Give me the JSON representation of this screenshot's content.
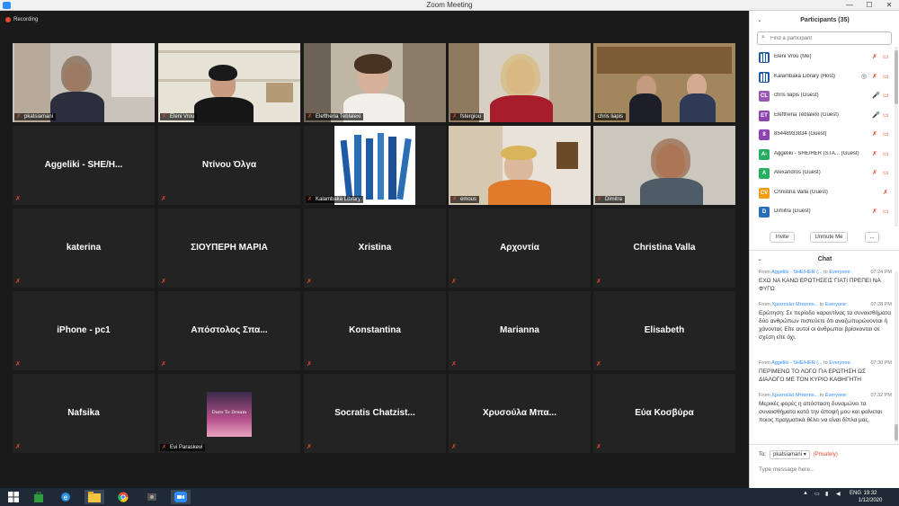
{
  "window": {
    "title": "Zoom Meeting",
    "minimize": "—",
    "maximize": "☐",
    "close": "✕"
  },
  "recording": {
    "label": "Recording"
  },
  "tiles": {
    "r1c1": {
      "name": "pkatsiamani"
    },
    "r1c2": {
      "name": "Eleni Vrou"
    },
    "r1c3": {
      "name": "Eleftheria Teblalexi"
    },
    "r1c4": {
      "name": "fstergiou"
    },
    "r1c5": {
      "name": "chris liapis"
    },
    "r2c1": {
      "big": "Aggeliki - SHE/H..."
    },
    "r2c2": {
      "big": "Ντίνου Όλγα"
    },
    "r2c3": {
      "name": "Kalambaka Library"
    },
    "r2c4": {
      "name": "emous"
    },
    "r2c5": {
      "name": "Dimitra"
    },
    "r3c1": {
      "big": "katerina"
    },
    "r3c2": {
      "big": "ΣΙΟΥΠΕΡΗ ΜΑΡΙΑ"
    },
    "r3c3": {
      "big": "Xristina"
    },
    "r3c4": {
      "big": "Αρχοντία"
    },
    "r3c5": {
      "big": "Christina Valla"
    },
    "r4c1": {
      "big": "iPhone - pc1"
    },
    "r4c2": {
      "big": "Απόστολος Σπα..."
    },
    "r4c3": {
      "big": "Konstantina"
    },
    "r4c4": {
      "big": "Marianna"
    },
    "r4c5": {
      "big": "Elisabeth"
    },
    "r5c1": {
      "big": "Nafsika"
    },
    "r5c2": {
      "name": "Evi Paraskevi",
      "image_text": "Dare To Dream"
    },
    "r5c3": {
      "big": "Socratis Chatzist..."
    },
    "r5c4": {
      "big": "Χρυσούλα Μπα..."
    },
    "r5c5": {
      "big": "Εύα Κοσβύρα"
    }
  },
  "participants": {
    "title": "Participants (35)",
    "search_placeholder": "Find a participant",
    "list": [
      {
        "initials": "",
        "color": "#2a6fb5",
        "name": "Eleni Vrou (Me)"
      },
      {
        "initials": "",
        "color": "#2a6fb5",
        "name": "Kalambaka Library (Host)"
      },
      {
        "initials": "CL",
        "color": "#9b59b6",
        "name": "chris liapis (Guest)"
      },
      {
        "initials": "ET",
        "color": "#8e44ad",
        "name": "Eleftheria Teblalexi (Guest)"
      },
      {
        "initials": "8",
        "color": "#8e44ad",
        "name": "85448933834 (Guest)"
      },
      {
        "initials": "A-",
        "color": "#27ae60",
        "name": "Aggeliki - SHE/HER (STA...  (Guest)"
      },
      {
        "initials": "A",
        "color": "#27ae60",
        "name": "Alexandros (Guest)"
      },
      {
        "initials": "CV",
        "color": "#f39c12",
        "name": "Christina Valla (Guest)"
      },
      {
        "initials": "D",
        "color": "#2a6fb5",
        "name": "Dimitra (Guest)"
      }
    ],
    "invite": "Invite",
    "unmute_me": "Unmute Me",
    "more": "..."
  },
  "chat": {
    "title": "Chat",
    "messages": [
      {
        "from_prefix": "From",
        "from": "Aggeliki - SHE/HER (...",
        "to_prefix": "to",
        "to": "Everyone:",
        "time": "07:24 PM",
        "text": "ΕΧΩ ΝΑ ΚΑΝΩ ΕΡΩΤΗΣΕΙΣ ΓΙΑΤΙ ΠΡΕΠΕΙ ΝΑ ΦΥΓΩ"
      },
      {
        "from_prefix": "From",
        "from": "Χρυσούλα Μπαντοι...",
        "to_prefix": "to",
        "to": "Everyone:",
        "time": "07:28 PM",
        "text": "Ερώτηση: Σε περίοδο καραντίνας τα συναισθήματα δύο ανθρώπων πιστεύετε ότι αναζωπυρώνονται ή χάνονται; Είτε αυτοί οι άνθρωποι βρίσκονται σε σχέση είτε όχι."
      },
      {
        "from_prefix": "From",
        "from": "Aggeliki - SHE/HER (...",
        "to_prefix": "to",
        "to": "Everyone:",
        "time": "07:30 PM",
        "text": "ΠΕΡΙΜΕΝΩ ΤΟ ΛΟΓΟ ΓΙΑ ΕΡΩΤΗΣΗ ΩΣ ΔΙΑΛΟΓΟ ΜΕ ΤΟΝ ΚΥΡΙΟ ΚΑΘΗΓΗΤΗ"
      },
      {
        "from_prefix": "From",
        "from": "Χρυσούλα Μπαντοι...",
        "to_prefix": "to",
        "to": "Everyone:",
        "time": "07:32 PM",
        "text": "Μερικές φορές η απόσταση δυναμώνει τα συναισθήματα κατά την άποψή μου και φαίνεται ποιος πραγματικά θέλει να είναι δίπλα μας."
      }
    ],
    "to_label": "To:",
    "to_value": "pkatsiamani ▾",
    "privately": "(Privately)",
    "input_placeholder": "Type message here..."
  },
  "taskbar": {
    "lang": "ENG",
    "time": "19:32",
    "date": "1/12/2020"
  }
}
